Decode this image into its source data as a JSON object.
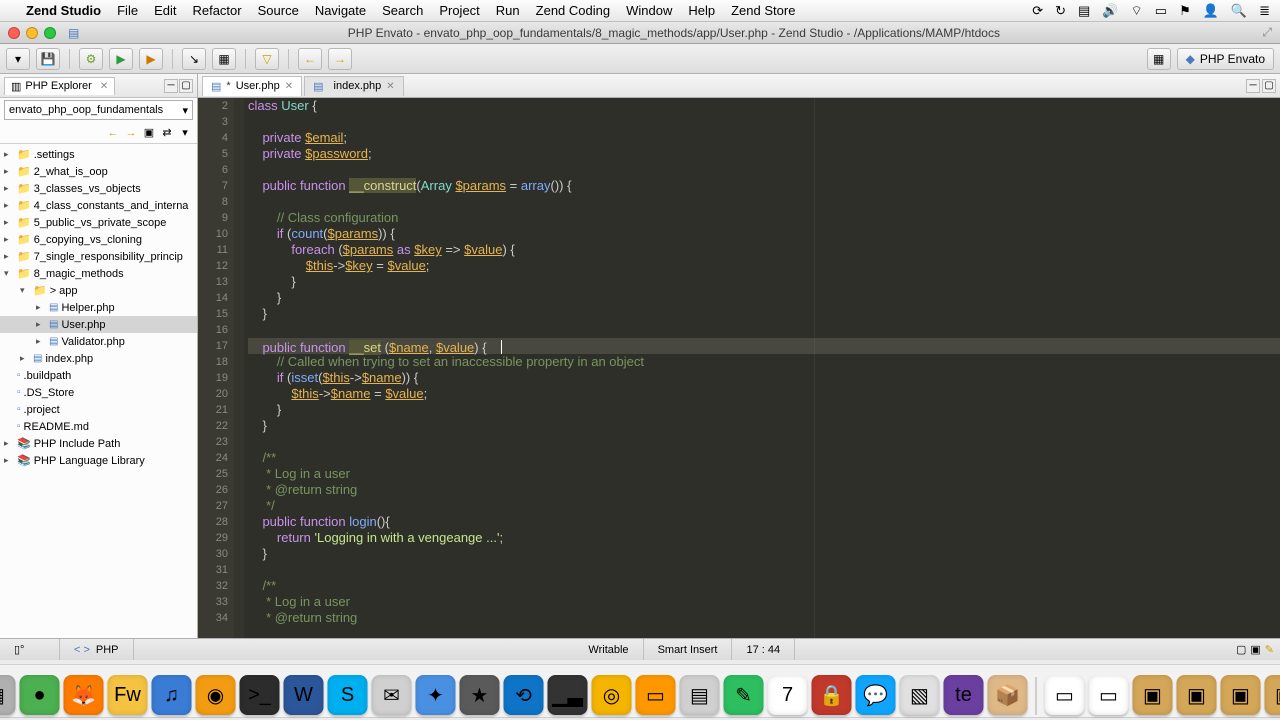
{
  "menubar": {
    "app": "Zend Studio",
    "items": [
      "File",
      "Edit",
      "Refactor",
      "Source",
      "Navigate",
      "Search",
      "Project",
      "Run",
      "Zend Coding",
      "Window",
      "Help",
      "Zend Store"
    ]
  },
  "window": {
    "title": "PHP Envato - envato_php_oop_fundamentals/8_magic_methods/app/User.php - Zend Studio - /Applications/MAMP/htdocs"
  },
  "perspective": {
    "label": "PHP Envato"
  },
  "sidebar": {
    "view_title": "PHP Explorer",
    "project_selector": "envato_php_oop_fundamentals",
    "tree": [
      {
        "label": ".settings",
        "icon": "folder",
        "depth": 0,
        "twisty": "▸"
      },
      {
        "label": "2_what_is_oop",
        "icon": "folder",
        "depth": 0,
        "twisty": "▸"
      },
      {
        "label": "3_classes_vs_objects",
        "icon": "folder",
        "depth": 0,
        "twisty": "▸"
      },
      {
        "label": "4_class_constants_and_interna",
        "icon": "folder",
        "depth": 0,
        "twisty": "▸"
      },
      {
        "label": "5_public_vs_private_scope",
        "icon": "folder",
        "depth": 0,
        "twisty": "▸"
      },
      {
        "label": "6_copying_vs_cloning",
        "icon": "folder",
        "depth": 0,
        "twisty": "▸"
      },
      {
        "label": "7_single_responsibility_princip",
        "icon": "folder",
        "depth": 0,
        "twisty": "▸"
      },
      {
        "label": "8_magic_methods",
        "icon": "folder",
        "depth": 0,
        "twisty": "▾"
      },
      {
        "label": "app",
        "icon": "folder",
        "depth": 1,
        "twisty": "▾",
        "prefix": "> "
      },
      {
        "label": "Helper.php",
        "icon": "php",
        "depth": 2,
        "twisty": "▸"
      },
      {
        "label": "User.php",
        "icon": "php",
        "depth": 2,
        "twisty": "▸",
        "selected": true
      },
      {
        "label": "Validator.php",
        "icon": "php",
        "depth": 2,
        "twisty": "▸"
      },
      {
        "label": "index.php",
        "icon": "php",
        "depth": 1,
        "twisty": "▸"
      },
      {
        "label": ".buildpath",
        "icon": "file",
        "depth": 0,
        "twisty": ""
      },
      {
        "label": ".DS_Store",
        "icon": "file",
        "depth": 0,
        "twisty": ""
      },
      {
        "label": ".project",
        "icon": "file",
        "depth": 0,
        "twisty": ""
      },
      {
        "label": "README.md",
        "icon": "file",
        "depth": 0,
        "twisty": ""
      },
      {
        "label": "PHP Include Path",
        "icon": "lib",
        "depth": 0,
        "twisty": "▸"
      },
      {
        "label": "PHP Language Library",
        "icon": "lib",
        "depth": 0,
        "twisty": "▸"
      }
    ]
  },
  "editor": {
    "tabs": [
      {
        "label": "User.php",
        "active": true,
        "dirty": true
      },
      {
        "label": "index.php",
        "active": false,
        "dirty": false
      }
    ],
    "first_line_number": 2,
    "highlighted_line_index": 15,
    "lines": [
      {
        "t": "class User {",
        "tokens": [
          [
            "kw",
            "class"
          ],
          [
            "",
            " "
          ],
          [
            "type",
            "User"
          ],
          [
            "",
            " {"
          ]
        ]
      },
      {
        "t": ""
      },
      {
        "t": "    private $email;",
        "tokens": [
          [
            "",
            "    "
          ],
          [
            "kw",
            "private"
          ],
          [
            "",
            " "
          ],
          [
            "var",
            "$email"
          ],
          [
            "",
            ";"
          ]
        ]
      },
      {
        "t": "    private $password;",
        "tokens": [
          [
            "",
            "    "
          ],
          [
            "kw",
            "private"
          ],
          [
            "",
            " "
          ],
          [
            "var",
            "$password"
          ],
          [
            "",
            ";"
          ]
        ]
      },
      {
        "t": ""
      },
      {
        "t": "    public function __construct(Array $params = array()) {",
        "tokens": [
          [
            "",
            "    "
          ],
          [
            "kw",
            "public"
          ],
          [
            "",
            " "
          ],
          [
            "kw",
            "function"
          ],
          [
            "",
            " "
          ],
          [
            "magic",
            "__construct"
          ],
          [
            "",
            "("
          ],
          [
            "type",
            "Array"
          ],
          [
            "",
            " "
          ],
          [
            "var",
            "$params"
          ],
          [
            "",
            " = "
          ],
          [
            "fn",
            "array"
          ],
          [
            "",
            "()) {"
          ]
        ]
      },
      {
        "t": ""
      },
      {
        "t": "        // Class configuration",
        "tokens": [
          [
            "",
            "        "
          ],
          [
            "cmt",
            "// Class configuration"
          ]
        ]
      },
      {
        "t": "        if (count($params)) {",
        "tokens": [
          [
            "",
            "        "
          ],
          [
            "kw",
            "if"
          ],
          [
            "",
            " ("
          ],
          [
            "fn",
            "count"
          ],
          [
            "",
            "("
          ],
          [
            "var",
            "$params"
          ],
          [
            "",
            ")) {"
          ]
        ]
      },
      {
        "t": "            foreach ($params as $key => $value) {",
        "tokens": [
          [
            "",
            "            "
          ],
          [
            "kw",
            "foreach"
          ],
          [
            "",
            " ("
          ],
          [
            "var",
            "$params"
          ],
          [
            "",
            " "
          ],
          [
            "kw",
            "as"
          ],
          [
            "",
            " "
          ],
          [
            "var",
            "$key"
          ],
          [
            "",
            " => "
          ],
          [
            "var",
            "$value"
          ],
          [
            "",
            ") {"
          ]
        ]
      },
      {
        "t": "                $this->$key = $value;",
        "tokens": [
          [
            "",
            "                "
          ],
          [
            "var",
            "$this"
          ],
          [
            "",
            "->"
          ],
          [
            "var",
            "$key"
          ],
          [
            "",
            " = "
          ],
          [
            "var",
            "$value"
          ],
          [
            "",
            ";"
          ]
        ]
      },
      {
        "t": "            }"
      },
      {
        "t": "        }"
      },
      {
        "t": "    }"
      },
      {
        "t": ""
      },
      {
        "t": "    public function __set ($name, $value) {",
        "tokens": [
          [
            "",
            "    "
          ],
          [
            "kw",
            "public"
          ],
          [
            "",
            " "
          ],
          [
            "kw",
            "function"
          ],
          [
            "",
            " "
          ],
          [
            "magic",
            "__set"
          ],
          [
            "",
            " ("
          ],
          [
            "var",
            "$name"
          ],
          [
            "",
            ", "
          ],
          [
            "var",
            "$value"
          ],
          [
            "",
            ") {    "
          ],
          [
            "cursor",
            ""
          ]
        ]
      },
      {
        "t": "        // Called when trying to set an inaccessible property in an object",
        "tokens": [
          [
            "",
            "        "
          ],
          [
            "cmt",
            "// Called when trying to set an inaccessible property in an object"
          ]
        ]
      },
      {
        "t": "        if (isset($this->$name)) {",
        "tokens": [
          [
            "",
            "        "
          ],
          [
            "kw",
            "if"
          ],
          [
            "",
            " ("
          ],
          [
            "fn",
            "isset"
          ],
          [
            "",
            "("
          ],
          [
            "var",
            "$this"
          ],
          [
            "",
            "->"
          ],
          [
            "var",
            "$name"
          ],
          [
            "",
            ")) {"
          ]
        ]
      },
      {
        "t": "            $this->$name = $value;",
        "tokens": [
          [
            "",
            "            "
          ],
          [
            "var",
            "$this"
          ],
          [
            "",
            "->"
          ],
          [
            "var",
            "$name"
          ],
          [
            "",
            " = "
          ],
          [
            "var",
            "$value"
          ],
          [
            "",
            ";"
          ]
        ]
      },
      {
        "t": "        }"
      },
      {
        "t": "    }"
      },
      {
        "t": ""
      },
      {
        "t": "    /**",
        "tokens": [
          [
            "",
            "    "
          ],
          [
            "cmt",
            "/**"
          ]
        ]
      },
      {
        "t": "     * Log in a user",
        "tokens": [
          [
            "",
            "     "
          ],
          [
            "cmt",
            "* Log in a user"
          ]
        ]
      },
      {
        "t": "     * @return string",
        "tokens": [
          [
            "",
            "     "
          ],
          [
            "cmt",
            "* @return string"
          ]
        ]
      },
      {
        "t": "     */",
        "tokens": [
          [
            "",
            "     "
          ],
          [
            "cmt",
            "*/"
          ]
        ]
      },
      {
        "t": "    public function login(){",
        "tokens": [
          [
            "",
            "    "
          ],
          [
            "kw",
            "public"
          ],
          [
            "",
            " "
          ],
          [
            "kw",
            "function"
          ],
          [
            "",
            " "
          ],
          [
            "fn",
            "login"
          ],
          [
            "",
            "(){"
          ]
        ]
      },
      {
        "t": "        return 'Logging in with a vengeange ...';",
        "tokens": [
          [
            "",
            "        "
          ],
          [
            "kw",
            "return"
          ],
          [
            "",
            " "
          ],
          [
            "str",
            "'Logging in with a vengeange ...'"
          ],
          [
            "",
            ";"
          ]
        ]
      },
      {
        "t": "    }"
      },
      {
        "t": ""
      },
      {
        "t": "    /**",
        "tokens": [
          [
            "",
            "    "
          ],
          [
            "cmt",
            "/**"
          ]
        ]
      },
      {
        "t": "     * Log in a user",
        "tokens": [
          [
            "",
            "     "
          ],
          [
            "cmt",
            "* Log in a user"
          ]
        ]
      },
      {
        "t": "     * @return string",
        "tokens": [
          [
            "",
            "     "
          ],
          [
            "cmt",
            "* @return string"
          ]
        ]
      }
    ]
  },
  "statusbar": {
    "lang": "PHP",
    "writable": "Writable",
    "insert": "Smart Insert",
    "pos": "17 : 44"
  },
  "dock": [
    {
      "name": "finder",
      "bg": "#6fa8dc",
      "g": "☺"
    },
    {
      "name": "launchpad",
      "bg": "#b0b0b0",
      "g": "▦"
    },
    {
      "name": "safari-green",
      "bg": "#4caf50",
      "g": "●"
    },
    {
      "name": "firefox",
      "bg": "#ff7b00",
      "g": "🦊"
    },
    {
      "name": "fireworks",
      "bg": "#f5c242",
      "g": "Fw"
    },
    {
      "name": "itunes",
      "bg": "#3a7bd5",
      "g": "♫"
    },
    {
      "name": "orange-app",
      "bg": "#f39c12",
      "g": "◉"
    },
    {
      "name": "terminal",
      "bg": "#2c2c2c",
      "g": ">_"
    },
    {
      "name": "word",
      "bg": "#2b579a",
      "g": "W"
    },
    {
      "name": "skype",
      "bg": "#00aff0",
      "g": "S"
    },
    {
      "name": "mail",
      "bg": "#d0d0d0",
      "g": "✉"
    },
    {
      "name": "safari",
      "bg": "#4a90e2",
      "g": "✦"
    },
    {
      "name": "imovie",
      "bg": "#5a5a5a",
      "g": "★"
    },
    {
      "name": "teamviewer",
      "bg": "#0e74c7",
      "g": "⟲"
    },
    {
      "name": "activity",
      "bg": "#333",
      "g": "▁▃"
    },
    {
      "name": "chrome",
      "bg": "#f4b400",
      "g": "◎"
    },
    {
      "name": "sublime",
      "bg": "#ff9800",
      "g": "▭"
    },
    {
      "name": "sqlpro",
      "bg": "#d0d0d0",
      "g": "▤"
    },
    {
      "name": "evernote",
      "bg": "#2dbe60",
      "g": "✎"
    },
    {
      "name": "calendar",
      "bg": "#fff",
      "g": "7"
    },
    {
      "name": "1password",
      "bg": "#c0392b",
      "g": "🔒"
    },
    {
      "name": "messages",
      "bg": "#0fa5ff",
      "g": "💬"
    },
    {
      "name": "preview",
      "bg": "#e0e0e0",
      "g": "▧"
    },
    {
      "name": "textmate",
      "bg": "#6b3fa0",
      "g": "te"
    },
    {
      "name": "box",
      "bg": "#deb887",
      "g": "📦"
    }
  ],
  "dock_right": [
    {
      "name": "doc1",
      "bg": "#fff",
      "g": "▭"
    },
    {
      "name": "doc2",
      "bg": "#fff",
      "g": "▭"
    },
    {
      "name": "folder1",
      "bg": "#d4a657",
      "g": "▣"
    },
    {
      "name": "folder2",
      "bg": "#d4a657",
      "g": "▣"
    },
    {
      "name": "folder3",
      "bg": "#d4a657",
      "g": "▣"
    },
    {
      "name": "folder4",
      "bg": "#d4a657",
      "g": "▣"
    },
    {
      "name": "trash",
      "bg": "#c0c0c0",
      "g": "🗑"
    }
  ]
}
